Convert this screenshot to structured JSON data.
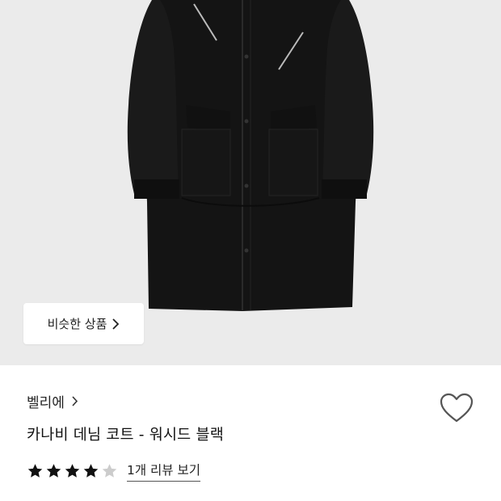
{
  "product": {
    "similar_button_label": "비슷한 상품",
    "brand": "벨리에",
    "title": "카나비 데님 코트 - 워시드 블랙",
    "rating": 4,
    "rating_max": 5,
    "review_link_label": "1개 리뷰 보기"
  },
  "icons": {
    "similar_chevron": "chevron-right-icon",
    "brand_chevron": "chevron-right-icon",
    "wishlist": "heart-outline-icon",
    "star": "star-icon"
  },
  "colors": {
    "image_background": "#ebebeb",
    "coat": "#141414",
    "star_filled": "#111111",
    "star_empty": "#cccccc",
    "heart_stroke": "#555555"
  }
}
